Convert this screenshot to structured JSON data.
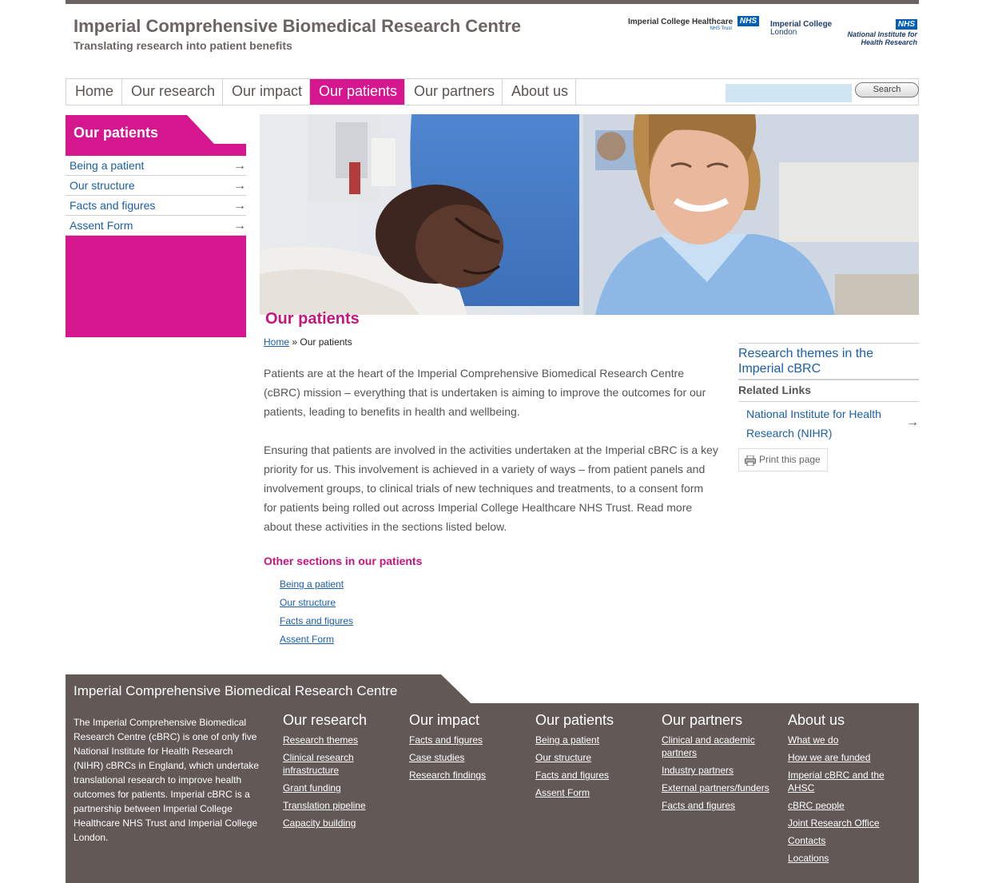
{
  "header": {
    "title": "Imperial Comprehensive Biomedical Research Centre",
    "tagline": "Translating research into patient benefits",
    "logos": {
      "ich_name": "Imperial College Healthcare",
      "ich_nhs": "NHS",
      "ich_trust": "NHS Trust",
      "icl_line1": "Imperial College",
      "icl_line2": "London",
      "nihr_nhs": "NHS",
      "nihr_line1": "National Institute for",
      "nihr_line2": "Health Research"
    }
  },
  "nav": {
    "items": [
      {
        "label": "Home"
      },
      {
        "label": "Our research"
      },
      {
        "label": "Our impact"
      },
      {
        "label": "Our patients"
      },
      {
        "label": "Our partners"
      },
      {
        "label": "About us"
      }
    ],
    "active": "Our patients",
    "search_button": "Search",
    "search_value": ""
  },
  "sidebar": {
    "title": "Our patients",
    "links": [
      {
        "label": "Being a patient"
      },
      {
        "label": "Our structure"
      },
      {
        "label": "Facts and figures"
      },
      {
        "label": "Assent Form"
      }
    ],
    "arrow": "→"
  },
  "main": {
    "title": "Our patients",
    "breadcrumb": {
      "home": "Home",
      "separator": "»",
      "current": "Our patients"
    },
    "paragraphs": [
      "Patients are at the heart of the Imperial Comprehensive Biomedical Research Centre (cBRC) mission – everything that is undertaken is aiming to improve the outcomes for our patients, leading to benefits in health and wellbeing.",
      "Ensuring that patients are involved in the activities undertaken at the Imperial cBRC is a key priority for us. This involvement is achieved in a variety of ways – from patient panels and involvement groups, to clinical trials of new techniques and treatments, to a consent form for patients being rolled out across Imperial College Healthcare NHS Trust. Read more about these activities in the sections listed below."
    ],
    "other_sections_title": "Other sections in our patients",
    "other_sections": [
      {
        "label": "Being a patient"
      },
      {
        "label": "Our structure"
      },
      {
        "label": "Facts and figures"
      },
      {
        "label": "Assent Form"
      }
    ]
  },
  "aside": {
    "theme_link": "Research themes in the Imperial cBRC",
    "related_title": "Related Links",
    "nihr_link": "National Institute for Health Research (NIHR)",
    "print_label": "Print this page"
  },
  "footer": {
    "title": "Imperial Comprehensive Biomedical Research Centre",
    "about": "The Imperial Comprehensive Biomedical Research Centre (cBRC) is one of only five National Institute for Health Research (NIHR) cBRCs in England, which undertake translational research to improve health outcomes for patients. Imperial cBRC is a partnership between Imperial College Healthcare NHS Trust and Imperial College London.",
    "columns": [
      {
        "heading": "Our research",
        "links": [
          "Research themes",
          "Clinical research infrastructure",
          "Grant funding",
          "Translation pipeline",
          "Capacity building"
        ]
      },
      {
        "heading": "Our impact",
        "links": [
          "Facts and figures",
          "Case studies",
          "Research findings"
        ]
      },
      {
        "heading": "Our patients",
        "links": [
          "Being a patient",
          "Our structure",
          "Facts and figures",
          "Assent Form"
        ]
      },
      {
        "heading": "Our partners",
        "links": [
          "Clinical and academic partners",
          "Industry partners",
          "External partners/funders",
          "Facts and figures"
        ]
      },
      {
        "heading": "About us",
        "links": [
          "What we do",
          "How we are funded",
          "Imperial cBRC and the AHSC",
          "cBRC people",
          "Joint Research Office",
          "Contacts",
          "Locations"
        ]
      }
    ]
  },
  "colors": {
    "accent": "#d6168f",
    "footer_bg": "#625957",
    "link": "#1a5fa8"
  }
}
